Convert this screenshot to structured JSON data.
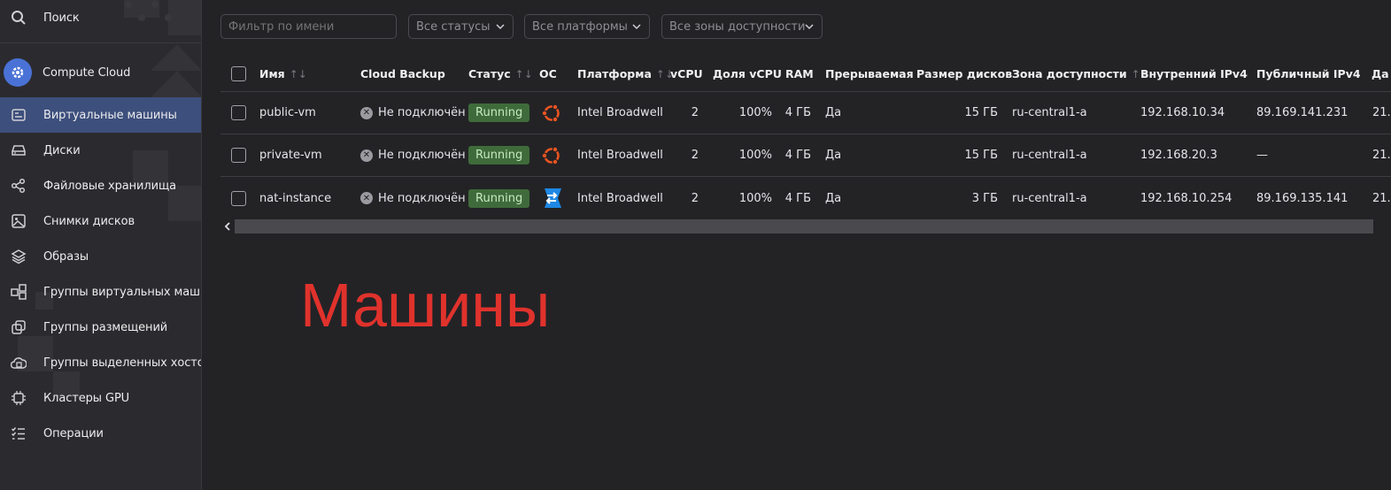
{
  "sidebar": {
    "search_label": "Поиск",
    "service_label": "Compute Cloud",
    "items": [
      {
        "label": "Виртуальные машины",
        "icon": "server-list-icon",
        "active": true
      },
      {
        "label": "Диски",
        "icon": "disk-icon"
      },
      {
        "label": "Файловые хранилища",
        "icon": "file-storage-icon"
      },
      {
        "label": "Снимки дисков",
        "icon": "snapshot-icon"
      },
      {
        "label": "Образы",
        "icon": "layers-icon"
      },
      {
        "label": "Группы виртуальных машин",
        "icon": "vm-group-icon"
      },
      {
        "label": "Группы размещений",
        "icon": "placement-group-icon"
      },
      {
        "label": "Группы выделенных хостов",
        "icon": "host-group-icon"
      },
      {
        "label": "Кластеры GPU",
        "icon": "gpu-chip-icon"
      },
      {
        "label": "Операции",
        "icon": "operations-list-icon"
      }
    ]
  },
  "filters": {
    "name_placeholder": "Фильтр по имени",
    "status": "Все статусы",
    "platform": "Все платформы",
    "zone": "Все зоны доступности"
  },
  "table": {
    "headers": {
      "name": "Имя",
      "backup": "Cloud Backup",
      "status": "Статус",
      "os": "ОС",
      "platform": "Платформа",
      "vcpu": "vCPU",
      "cpu_share": "Доля vCPU",
      "ram": "RAM",
      "preemptible": "Прерываемая",
      "disk_size": "Размер дисков",
      "zone": "Зона доступности",
      "internal_ip": "Внутренний IPv4",
      "public_ip": "Публичный IPv4",
      "date": "Да"
    },
    "rows": [
      {
        "name": "public-vm",
        "backup": "Не подключён",
        "status": "Running",
        "os": "ubuntu",
        "platform": "Intel Broadwell",
        "vcpu": "2",
        "cpu_share": "100%",
        "ram": "4 ГБ",
        "preemptible": "Да",
        "disk_size": "15 ГБ",
        "zone": "ru-central1-a",
        "internal_ip": "192.168.10.34",
        "public_ip": "89.169.141.231",
        "date": "21."
      },
      {
        "name": "private-vm",
        "backup": "Не подключён",
        "status": "Running",
        "os": "ubuntu",
        "platform": "Intel Broadwell",
        "vcpu": "2",
        "cpu_share": "100%",
        "ram": "4 ГБ",
        "preemptible": "Да",
        "disk_size": "15 ГБ",
        "zone": "ru-central1-a",
        "internal_ip": "192.168.20.3",
        "public_ip": "—",
        "date": "21."
      },
      {
        "name": "nat-instance",
        "backup": "Не подключён",
        "status": "Running",
        "os": "nat",
        "platform": "Intel Broadwell",
        "vcpu": "2",
        "cpu_share": "100%",
        "ram": "4 ГБ",
        "preemptible": "Да",
        "disk_size": "3 ГБ",
        "zone": "ru-central1-a",
        "internal_ip": "192.168.10.254",
        "public_ip": "89.169.135.141",
        "date": "21."
      }
    ]
  },
  "overlay_caption": "Машины",
  "colors": {
    "accent": "#3d4f7c",
    "running_badge": "#3f6b3a",
    "ubuntu": "#e95420",
    "nat": "#1e88e5",
    "caption": "#e0322c"
  }
}
